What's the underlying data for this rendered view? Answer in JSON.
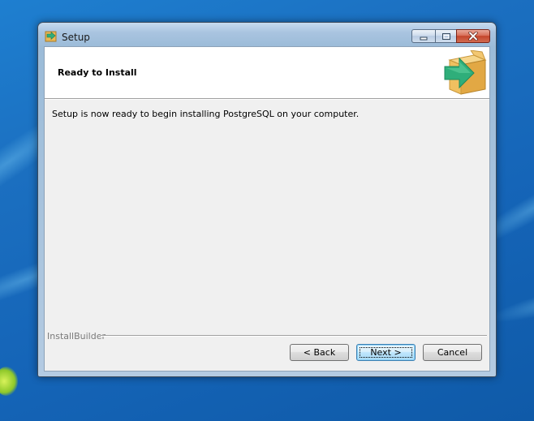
{
  "window": {
    "title": "Setup",
    "icon": "installer-arrow-icon"
  },
  "caption_buttons": {
    "minimize_icon": "minimize-icon",
    "maximize_icon": "maximize-icon",
    "close_icon": "close-icon"
  },
  "header": {
    "title": "Ready to Install",
    "logo_icon": "box-arrow-icon"
  },
  "main": {
    "message": "Setup is now ready to begin installing PostgreSQL on your computer."
  },
  "footer": {
    "brand": "InstallBuilder",
    "back_label": "< Back",
    "next_label": "Next >",
    "cancel_label": "Cancel"
  },
  "colors": {
    "desktop": "#1b6fc0",
    "close_button": "#c4452b",
    "logo_arrow": "#2fae7a",
    "logo_box": "#f0c060"
  }
}
